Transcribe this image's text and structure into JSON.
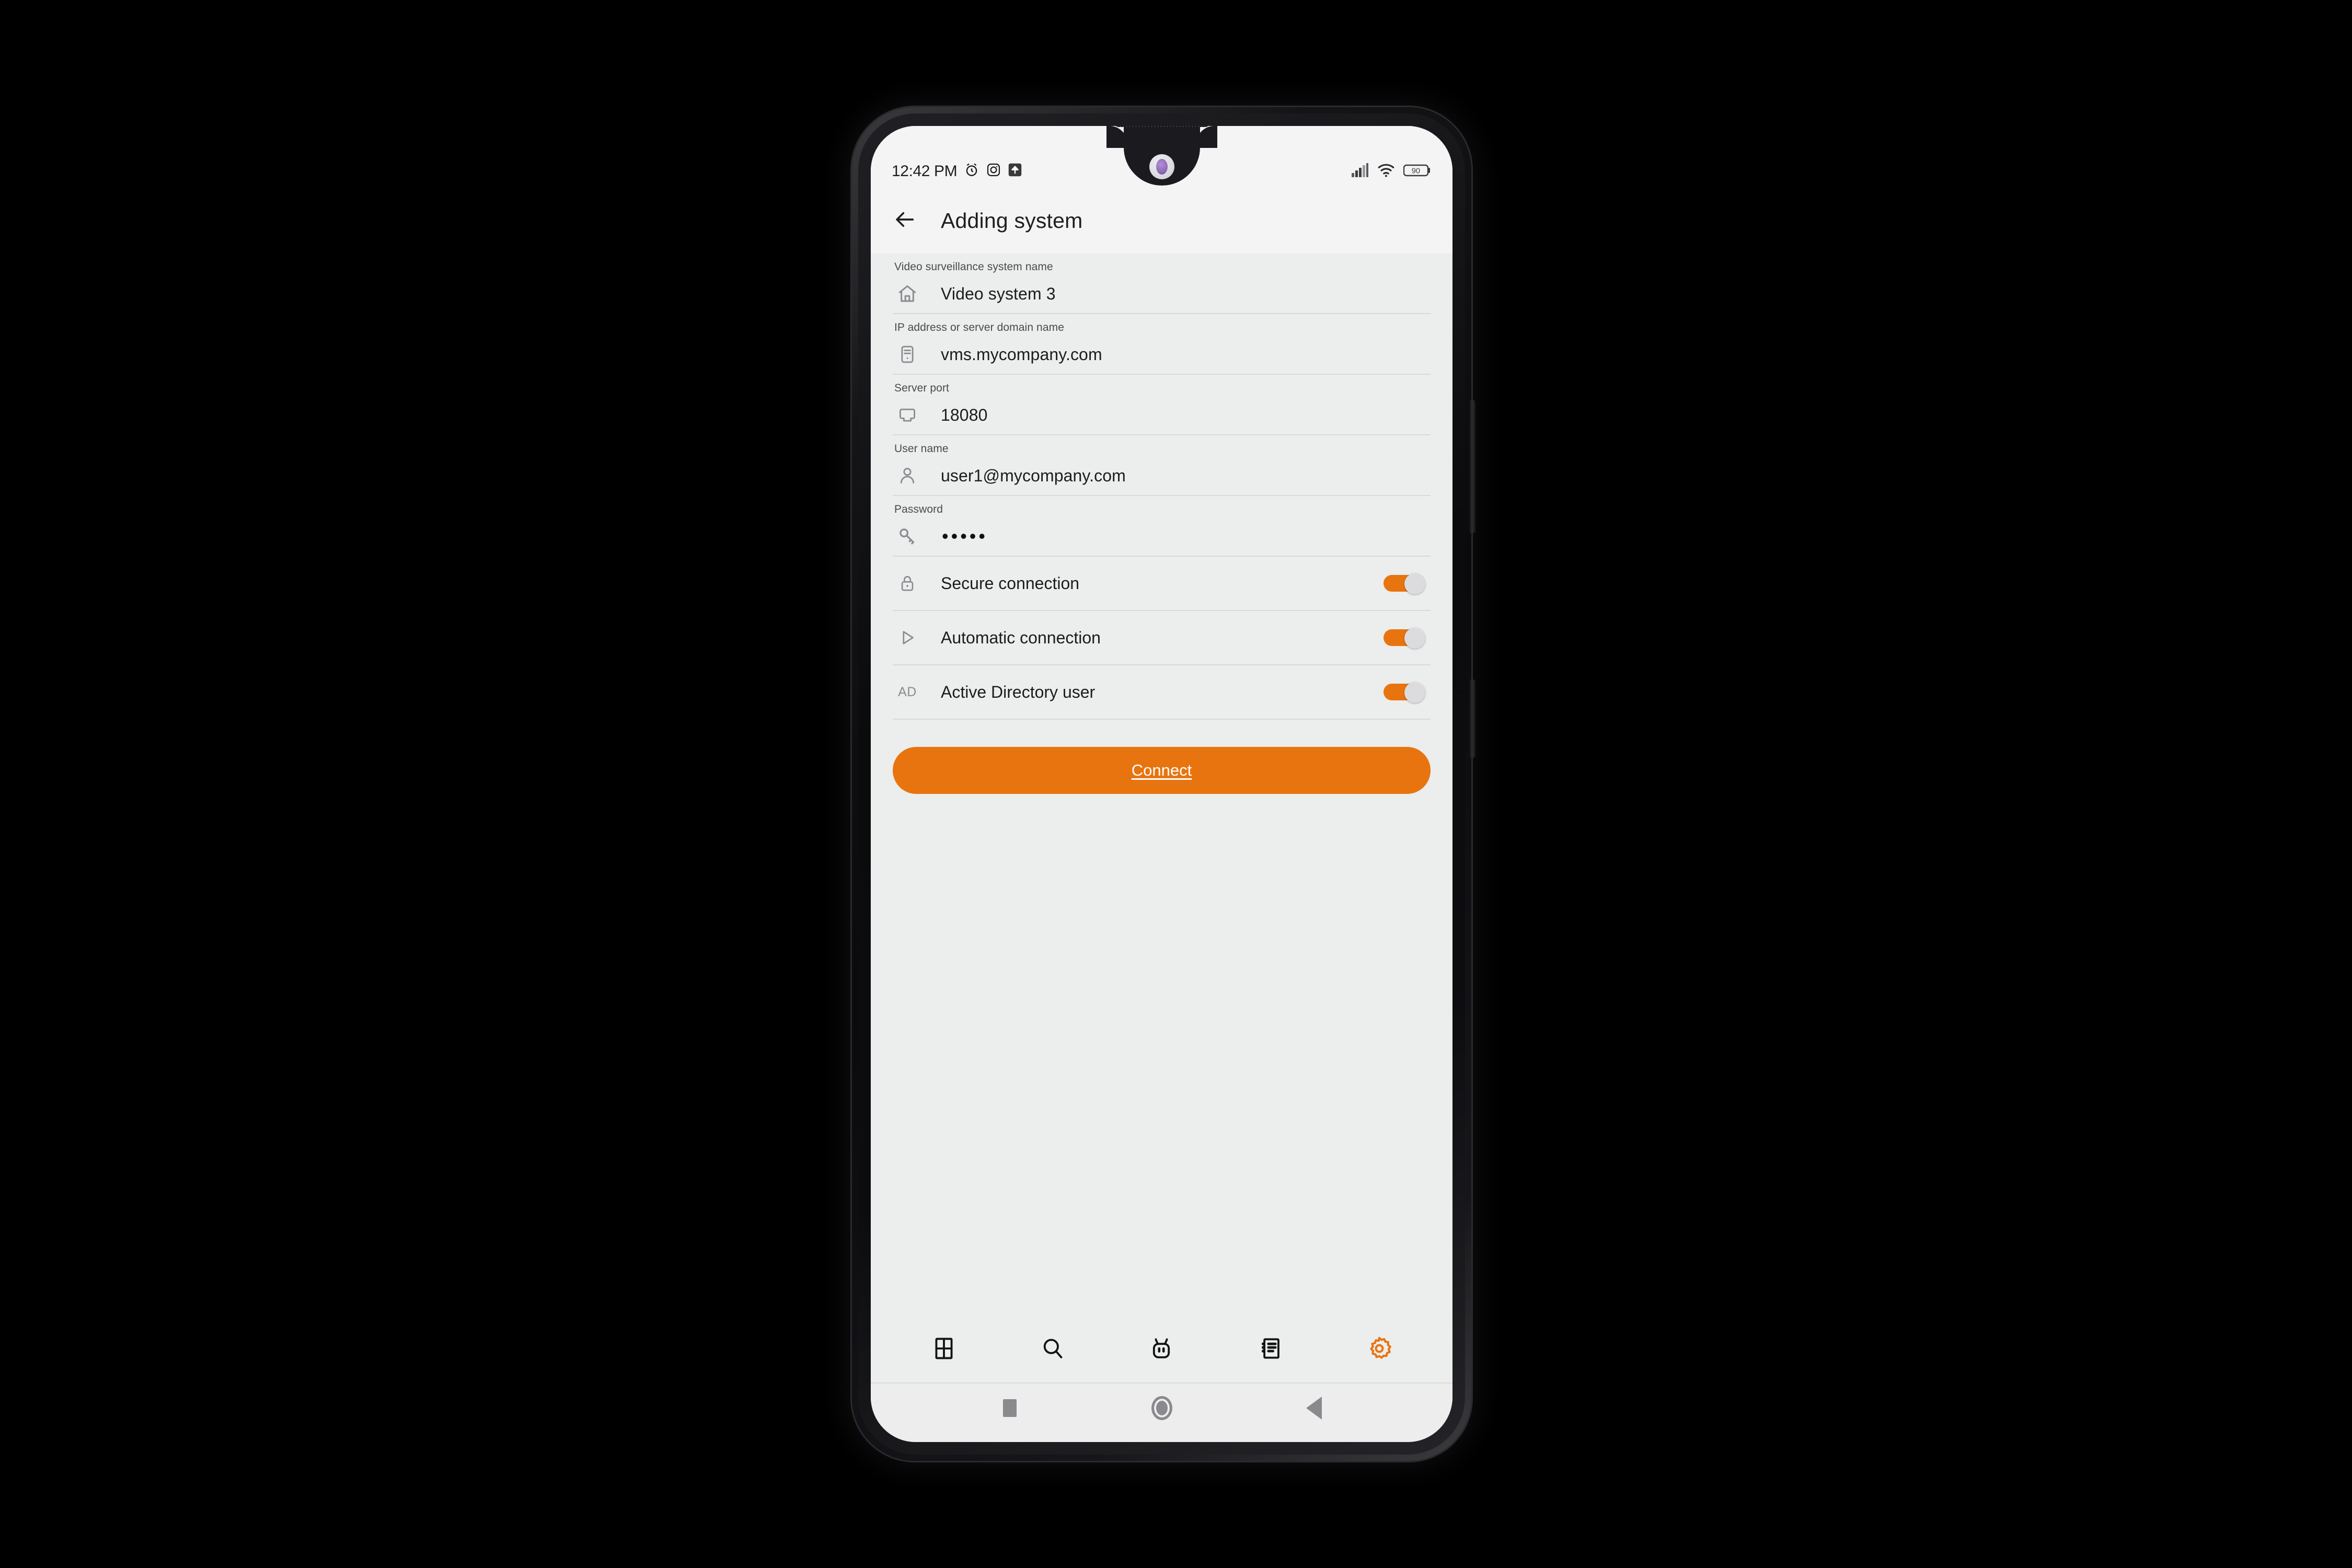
{
  "status_bar": {
    "time": "12:42 PM",
    "icons_left": [
      "alarm-clock-icon",
      "instagram-icon",
      "upload-icon"
    ],
    "icons_right": [
      "cellular-signal-icon",
      "wifi-icon",
      "battery-icon"
    ],
    "battery_level": "90"
  },
  "header": {
    "back_icon": "back-arrow-icon",
    "title": "Adding system"
  },
  "form": {
    "fields": [
      {
        "label": "Video surveillance system name",
        "value": "Video system 3",
        "icon": "home-icon",
        "type": "text"
      },
      {
        "label": "IP address or server domain name",
        "value": "vms.mycompany.com",
        "icon": "server-icon",
        "type": "text"
      },
      {
        "label": "Server port",
        "value": "18080",
        "icon": "ethernet-port-icon",
        "type": "text"
      },
      {
        "label": "User name",
        "value": "user1@mycompany.com",
        "icon": "person-icon",
        "type": "text"
      },
      {
        "label": "Password",
        "value": "•••••",
        "icon": "key-icon",
        "type": "password"
      }
    ],
    "toggles": [
      {
        "label": "Secure connection",
        "icon": "lock-icon",
        "state": "on"
      },
      {
        "label": "Automatic connection",
        "icon": "play-icon",
        "state": "on"
      },
      {
        "label": "Active Directory user",
        "icon": "ad-text-icon",
        "icon_text": "AD",
        "state": "on"
      }
    ],
    "connect_label": "Connect"
  },
  "bottom_nav": {
    "items": [
      {
        "icon": "grid-layout-icon",
        "active": false
      },
      {
        "icon": "search-icon",
        "active": false
      },
      {
        "icon": "bot-icon",
        "active": false
      },
      {
        "icon": "journal-list-icon",
        "active": false
      },
      {
        "icon": "gear-icon",
        "active": true
      }
    ],
    "active_color": "#E8740F"
  },
  "system_nav": {
    "items": [
      "recents-square-icon",
      "home-circle-icon",
      "back-triangle-icon"
    ]
  },
  "colors": {
    "accent": "#E8740F",
    "screen_bg": "#eceded",
    "header_bg": "#f4f4f4"
  }
}
